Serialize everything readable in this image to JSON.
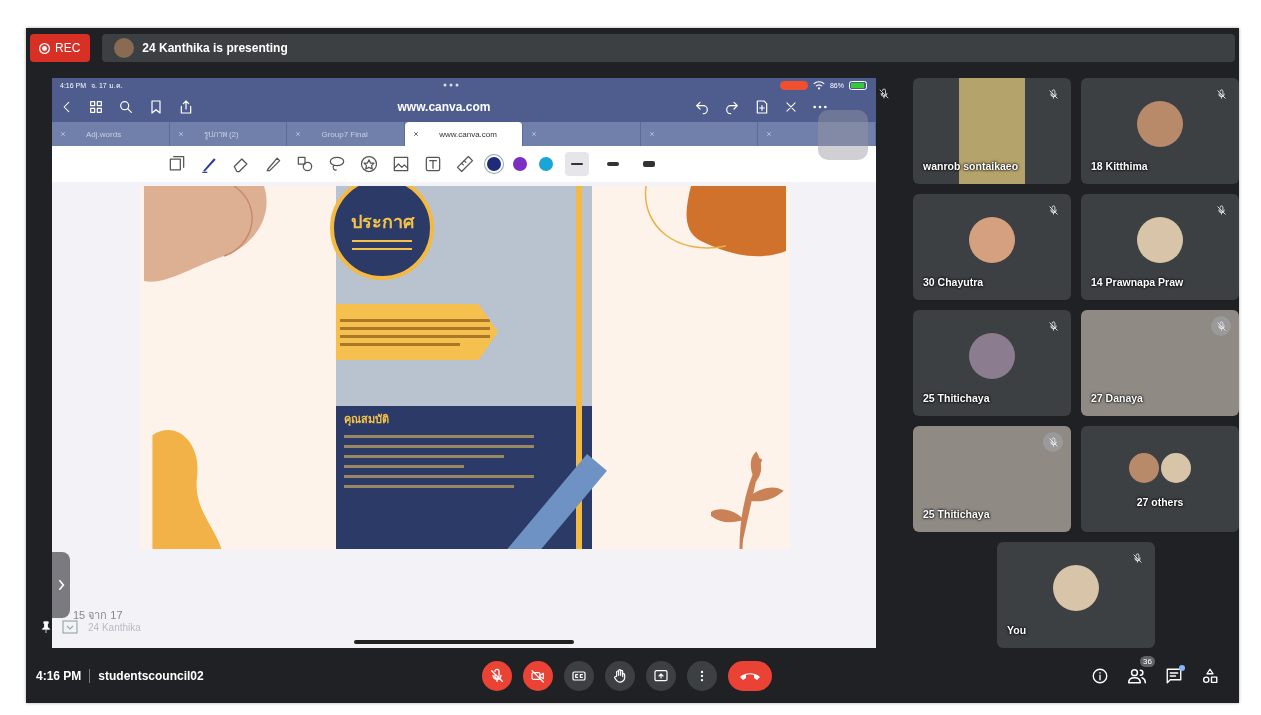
{
  "recording": {
    "label": "REC"
  },
  "presenting_banner": {
    "text": "24 Kanthika is presenting"
  },
  "shared_screen": {
    "status_bar": {
      "time": "4:16 PM",
      "date": "จ. 17 ม.ค.",
      "battery": "86%"
    },
    "browser": {
      "url": "www.canva.com",
      "tabs": [
        {
          "label": "Adj.words",
          "selected": false
        },
        {
          "label": "รูปภาพ (2)",
          "selected": false
        },
        {
          "label": "Group7 Final",
          "selected": false
        },
        {
          "label": "www.canva.com",
          "selected": true
        },
        {
          "selected": false
        },
        {
          "selected": false
        },
        {
          "selected": false
        }
      ]
    },
    "pen_colors": [
      {
        "color": "#1f2a7a",
        "selected": true
      },
      {
        "color": "#7a2fc0",
        "selected": false
      },
      {
        "color": "#1aa5d8",
        "selected": false
      }
    ],
    "stroke_widths": [
      {
        "selected": true
      },
      {
        "selected": false
      },
      {
        "selected": false
      }
    ],
    "poster": {
      "title": "ประกาศ",
      "heading": "คุณสมบัติ"
    },
    "page_indicator": "15 จาก 17",
    "presenter_label": "24 Kanthika"
  },
  "participants": [
    {
      "name": "wanrob sontaikaeo",
      "kind": "video",
      "muted": true
    },
    {
      "name": "18 Kitthima",
      "kind": "avatar",
      "muted": true
    },
    {
      "name": "30 Chayutra",
      "kind": "avatar",
      "muted": true
    },
    {
      "name": "14 Prawnapa Praw",
      "kind": "avatar",
      "muted": true
    },
    {
      "name": "25 Thitichaya",
      "kind": "avatar",
      "muted": true
    },
    {
      "name": "27 Danaya",
      "kind": "video_full",
      "muted": true
    },
    {
      "name": "25 Thitichaya",
      "kind": "video_full",
      "muted": true
    },
    {
      "name": "27 others",
      "kind": "group",
      "muted": false
    },
    {
      "name": "You",
      "kind": "avatar",
      "muted": true
    }
  ],
  "meeting": {
    "time": "4:16 PM",
    "code": "studentscouncil02"
  },
  "call_controls": [
    {
      "kind": "mic",
      "on": false
    },
    {
      "kind": "camera",
      "on": false
    },
    {
      "kind": "captions",
      "on": false
    },
    {
      "kind": "hand",
      "on": false
    },
    {
      "kind": "present",
      "on": false
    }
  ],
  "side_controls": {
    "people_count": "36",
    "chat_unread": true
  }
}
